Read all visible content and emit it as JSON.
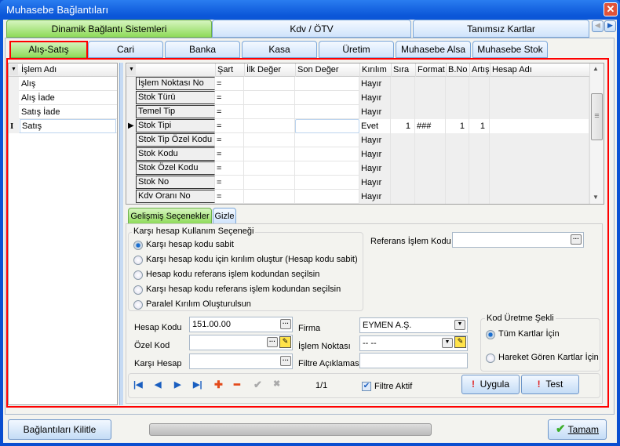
{
  "window": {
    "title": "Muhasebe Bağlantıları",
    "close": "✕"
  },
  "top_tabs": [
    "Dinamik Bağlantı Sistemleri",
    "Kdv / ÖTV",
    "Tanımsız Kartlar"
  ],
  "sub_tabs": [
    "Alış-Satış",
    "Cari",
    "Banka",
    "Kasa",
    "Üretim",
    "Muhasebe Alsa",
    "Muhasebe Stok"
  ],
  "left_grid": {
    "header": "İşlem Adı",
    "rows": [
      "Alış",
      "Alış İade",
      "Satış İade",
      "Satış"
    ],
    "selected": "Satış"
  },
  "main_grid": {
    "columns": [
      "",
      "Şart",
      "İlk Değer",
      "Son Değer",
      "Kırılım",
      "Sıra",
      "Format",
      "B.No",
      "Artış",
      "Hesap Adı"
    ],
    "rows": [
      {
        "name": "İşlem Noktası No",
        "sart": "=",
        "ilk": "",
        "son": "",
        "kirilim": "Hayır",
        "sira": "",
        "format": "",
        "bno": "",
        "artis": "",
        "hesap": ""
      },
      {
        "name": "Stok Türü",
        "sart": "=",
        "ilk": "",
        "son": "",
        "kirilim": "Hayır",
        "sira": "",
        "format": "",
        "bno": "",
        "artis": "",
        "hesap": ""
      },
      {
        "name": "Temel Tip",
        "sart": "=",
        "ilk": "",
        "son": "",
        "kirilim": "Hayır",
        "sira": "",
        "format": "",
        "bno": "",
        "artis": "",
        "hesap": ""
      },
      {
        "name": "Stok Tipi",
        "sart": "=",
        "ilk": "",
        "son": "",
        "kirilim": "Evet",
        "sira": "1",
        "format": "###",
        "bno": "1",
        "artis": "1",
        "hesap": ""
      },
      {
        "name": "Stok Tip Özel Kodu",
        "sart": "=",
        "ilk": "",
        "son": "",
        "kirilim": "Hayır",
        "sira": "",
        "format": "",
        "bno": "",
        "artis": "",
        "hesap": ""
      },
      {
        "name": "Stok Kodu",
        "sart": "=",
        "ilk": "",
        "son": "",
        "kirilim": "Hayır",
        "sira": "",
        "format": "",
        "bno": "",
        "artis": "",
        "hesap": ""
      },
      {
        "name": "Stok Özel Kodu",
        "sart": "=",
        "ilk": "",
        "son": "",
        "kirilim": "Hayır",
        "sira": "",
        "format": "",
        "bno": "",
        "artis": "",
        "hesap": ""
      },
      {
        "name": "Stok No",
        "sart": "=",
        "ilk": "",
        "son": "",
        "kirilim": "Hayır",
        "sira": "",
        "format": "",
        "bno": "",
        "artis": "",
        "hesap": ""
      },
      {
        "name": "Kdv Oranı No",
        "sart": "=",
        "ilk": "",
        "son": "",
        "kirilim": "Hayır",
        "sira": "",
        "format": "",
        "bno": "",
        "artis": "",
        "hesap": ""
      }
    ],
    "current_row": 3
  },
  "lower_tabs": [
    "Gelişmiş Seçenekler",
    "Gizle"
  ],
  "karsi_hesap": {
    "legend": "Karşı hesap Kullanım Seçeneği",
    "options": [
      "Karşı hesap kodu sabit",
      "Karşı hesap kodu için kırılım oluştur (Hesap kodu sabit)",
      "Hesap kodu referans işlem kodundan seçilsin",
      "Karşı hesap kodu referans işlem kodundan seçilsin",
      "Paralel Kırılım Oluşturulsun"
    ],
    "selected": 0
  },
  "form": {
    "referans_label": "Referans İşlem Kodu",
    "referans_value": "",
    "hesap_kodu_label": "Hesap Kodu",
    "hesap_kodu_value": "151.00.00",
    "ozel_kod_label": "Özel Kod",
    "ozel_kod_value": "",
    "karsi_hesap_label": "Karşı Hesap",
    "karsi_hesap_value": "",
    "firma_label": "Firma",
    "firma_value": "EYMEN A.Ş.",
    "islem_noktasi_label": "İşlem Noktası",
    "islem_noktasi_value": "-- --",
    "filtre_label": "Filtre Açıklaması",
    "filtre_value": ""
  },
  "kod_uretme": {
    "legend": "Kod Üretme Şekli",
    "options": [
      "Tüm Kartlar İçin",
      "Hareket Gören Kartlar İçin"
    ],
    "selected": 0
  },
  "navigator": {
    "first": "|◀",
    "prev": "◀",
    "next": "▶",
    "last": "▶|",
    "add": "✚",
    "delete": "━",
    "post": "✔",
    "cancel": "✖",
    "position": "1/1"
  },
  "filtre_aktif": {
    "label": "Filtre Aktif",
    "checked": true
  },
  "buttons": {
    "uygula": "Uygula",
    "test": "Test",
    "kilitle": "Bağlantıları Kilitle",
    "tamam": "Tamam"
  },
  "progress": 0
}
